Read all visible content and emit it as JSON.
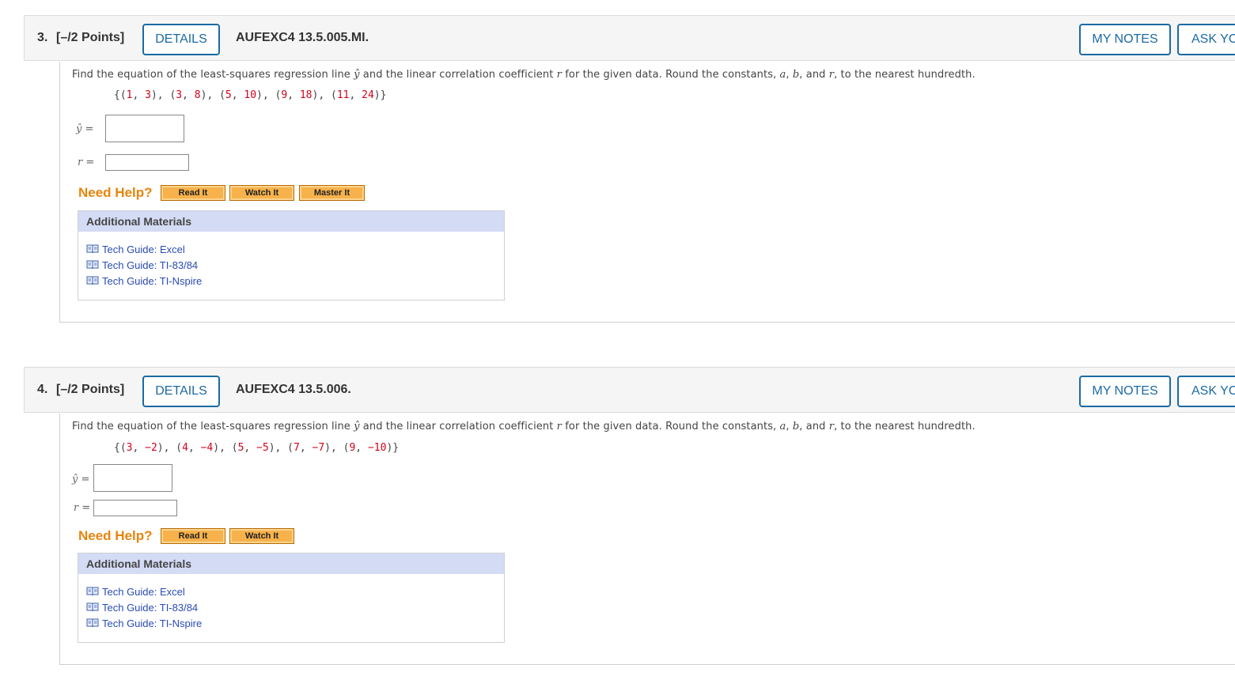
{
  "questions": [
    {
      "number": "3.",
      "points": "[–/2 Points]",
      "details_label": "DETAILS",
      "code": "AUFEXC4 13.5.005.MI.",
      "my_notes_label": "MY NOTES",
      "ask_label": "ASK YO",
      "prompt_before_yhat": "Find the equation of the least-squares regression line ",
      "yhat_symbol": "ŷ",
      "prompt_mid": " and the linear correlation coefficient ",
      "r_symbol": "r",
      "prompt_after_r": " for the given data. Round the constants, ",
      "a_symbol": "a",
      "comma1": ", ",
      "b_symbol": "b",
      "and_text": ", and ",
      "r2_symbol": "r",
      "prompt_end": ", to the nearest hundredth.",
      "dataset": [
        [
          "1",
          "3"
        ],
        [
          "3",
          "8"
        ],
        [
          "5",
          "10"
        ],
        [
          "9",
          "18"
        ],
        [
          "11",
          "24"
        ]
      ],
      "yhat_label": "ŷ",
      "r_label": "r",
      "eq_sign": " =",
      "yhat_answer": "",
      "r_answer": "",
      "need_help": "Need Help?",
      "help_buttons": [
        "Read It",
        "Watch It",
        "Master It"
      ],
      "additional_materials_title": "Additional Materials",
      "materials": [
        "Tech Guide: Excel",
        "Tech Guide: TI-83/84",
        "Tech Guide: TI-Nspire"
      ]
    },
    {
      "number": "4.",
      "points": "[–/2 Points]",
      "details_label": "DETAILS",
      "code": "AUFEXC4 13.5.006.",
      "my_notes_label": "MY NOTES",
      "ask_label": "ASK YO",
      "prompt_before_yhat": "Find the equation of the least-squares regression line ",
      "yhat_symbol": "ŷ",
      "prompt_mid": " and the linear correlation coefficient ",
      "r_symbol": "r",
      "prompt_after_r": " for the given data. Round the constants, ",
      "a_symbol": "a",
      "comma1": ", ",
      "b_symbol": "b",
      "and_text": ", and ",
      "r2_symbol": "r",
      "prompt_end": ", to the nearest hundredth.",
      "dataset": [
        [
          "3",
          "−2"
        ],
        [
          "4",
          "−4"
        ],
        [
          "5",
          "−5"
        ],
        [
          "7",
          "−7"
        ],
        [
          "9",
          "−10"
        ]
      ],
      "yhat_label": "ŷ",
      "r_label": "r",
      "eq_sign": " =",
      "yhat_answer": "",
      "r_answer": "",
      "need_help": "Need Help?",
      "help_buttons": [
        "Read It",
        "Watch It"
      ],
      "additional_materials_title": "Additional Materials",
      "materials": [
        "Tech Guide: Excel",
        "Tech Guide: TI-83/84",
        "Tech Guide: TI-Nspire"
      ]
    }
  ],
  "colors": {
    "accent_blue": "#1b6aa3",
    "need_help_orange": "#e8840c",
    "data_red": "#d0021b",
    "link_blue": "#2a4bb5",
    "materials_header": "#d4dbf5"
  },
  "icons": {
    "material_icon": "open-book-icon"
  }
}
